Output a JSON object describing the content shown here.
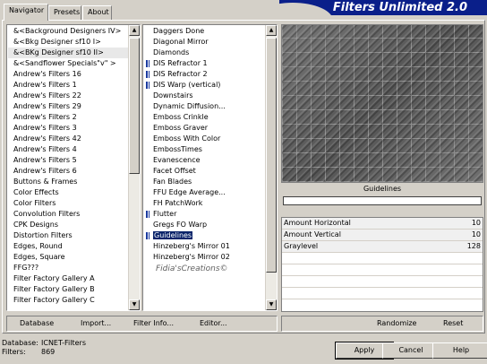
{
  "tabs": {
    "navigator": "Navigator",
    "presets": "Presets",
    "about": "About"
  },
  "banner": {
    "title": "Filters Unlimited 2.0"
  },
  "categories": [
    "&<Background Designers IV>",
    "&<Bkg Designer sf10 I>",
    "&<BKg Designer sf10 II>",
    "&<Sandflower Specials\"v\" >",
    "Andrew's Filters 16",
    "Andrew's Filters 1",
    "Andrew's Filters 22",
    "Andrew's Filters 29",
    "Andrew's Filters 2",
    "Andrew's Filters 3",
    "Andrew's Filters 42",
    "Andrew's Filters 4",
    "Andrew's Filters 5",
    "Andrew's Filters 6",
    "Buttons & Frames",
    "Color Effects",
    "Color Filters",
    "Convolution Filters",
    "CPK Designs",
    "Distortion Filters",
    "Edges, Round",
    "Edges, Square",
    "FFG???",
    "Filter Factory Gallery A",
    "Filter Factory Gallery B",
    "Filter Factory Gallery C"
  ],
  "filters": [
    "Daggers Done",
    "Diagonal Mirror",
    "Diamonds",
    "DIS Refractor 1",
    "DIS Refractor 2",
    "DIS Warp (vertical)",
    "Downstairs",
    "Dynamic Diffusion...",
    "Emboss Crinkle",
    "Emboss Graver",
    "Emboss With Color",
    "EmbossTimes",
    "Evanescence",
    "Facet Offset",
    "Fan Blades",
    "FFU Edge Average...",
    "FH PatchWork",
    "Flutter",
    "Gregs FO Warp",
    "Guidelines",
    "Hinzeberg's Mirror 01",
    "Hinzeberg's Mirror 02"
  ],
  "watermark": "Fidia'sCreations©",
  "left_buttons": {
    "database": "Database",
    "import": "Import...",
    "filter_info": "Filter Info...",
    "editor": "Editor..."
  },
  "filter_name": "Guidelines",
  "params": [
    {
      "label": "Amount Horizontal",
      "value": "10"
    },
    {
      "label": "Amount Vertical",
      "value": "10"
    },
    {
      "label": "Graylevel",
      "value": "128"
    }
  ],
  "right_buttons": {
    "randomize": "Randomize",
    "reset": "Reset"
  },
  "status": {
    "database_label": "Database:",
    "database_value": "ICNET-Filters",
    "filters_label": "Filters:",
    "filters_value": "869"
  },
  "dialog_buttons": {
    "apply": "Apply",
    "cancel": "Cancel",
    "help": "Help"
  },
  "colors": {
    "banner": "#0a1f8a",
    "selection": "#0a246a",
    "face": "#d4d0c8"
  }
}
